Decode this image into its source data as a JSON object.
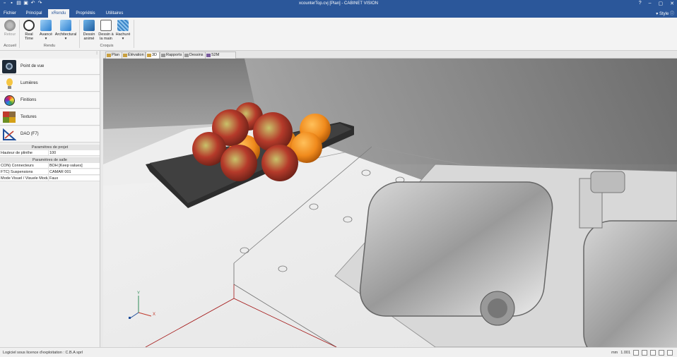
{
  "window": {
    "title": "xcounterTop.cvj [Plan] - CABINET VISION",
    "controls": [
      "?",
      "–",
      "▢",
      "✕"
    ]
  },
  "tabs": [
    {
      "label": "Fichier"
    },
    {
      "label": "Principal"
    },
    {
      "label": "xRendu"
    },
    {
      "label": "Propriétés"
    },
    {
      "label": "Utilitaires"
    }
  ],
  "style_menu": "Style",
  "ribbon": {
    "retour": "Retour",
    "realtime": "Real Time",
    "avance": "Avancé",
    "architectural": "Architectural",
    "dessin_anime": "Dessin animé",
    "dessin_main": "Dessin à la main",
    "hachure": "Hachuré",
    "group_accueil": "Accueil",
    "group_rendu": "Rendu",
    "group_croquis": "Croquis"
  },
  "left_panel": {
    "items": [
      {
        "label": "Point de vue"
      },
      {
        "label": "Lumières"
      },
      {
        "label": "Finitions"
      },
      {
        "label": "Textures"
      },
      {
        "label": "DAO (F7)"
      }
    ],
    "project_section": "Paramètres de projet",
    "project_rows": [
      {
        "key": "Hauteur de plinthe",
        "value": "100"
      }
    ],
    "room_section": "Paramètres de salle",
    "room_rows": [
      {
        "key": "CON) Connecteurs",
        "value": "ВОН [Keep values]"
      },
      {
        "key": "FTC) Suspensions",
        "value": "CAMAR 001"
      },
      {
        "key": "Mode Visuel / Visuele Modu",
        "value": "Faux"
      }
    ]
  },
  "doc_tabs": [
    {
      "label": "Plan"
    },
    {
      "label": "Élévation"
    },
    {
      "label": "3D"
    },
    {
      "label": "Rapports"
    },
    {
      "label": "Dessins"
    },
    {
      "label": "S2M CENTER"
    }
  ],
  "axis": {
    "x": "X",
    "y": "Y"
  },
  "status": {
    "license": "Logiciel sous licence d'exploitation : C.B.A sprl",
    "unit": "mm",
    "zoom": "1.001"
  },
  "colors": {
    "accent": "#2b579a"
  }
}
